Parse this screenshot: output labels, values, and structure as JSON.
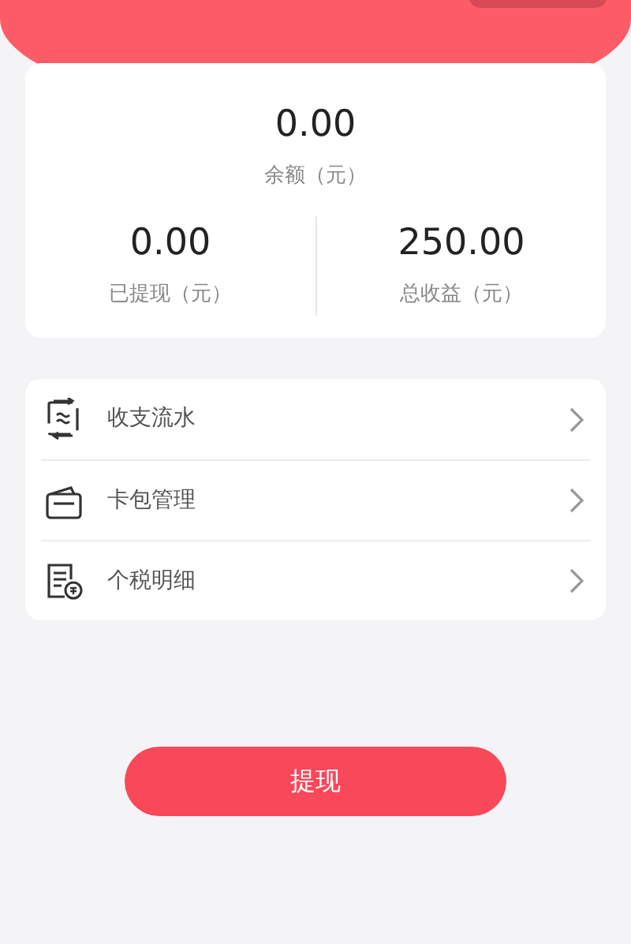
{
  "summary": {
    "balance": {
      "value": "0.00",
      "label": "余额（元）"
    },
    "stats": [
      {
        "value": "0.00",
        "label": "已提现（元）"
      },
      {
        "value": "250.00",
        "label": "总收益（元）"
      }
    ]
  },
  "menu": [
    {
      "kind": "flow",
      "label": "收支流水"
    },
    {
      "kind": "wallet",
      "label": "卡包管理"
    },
    {
      "kind": "tax",
      "label": "个税明细"
    }
  ],
  "action_button": "提现"
}
